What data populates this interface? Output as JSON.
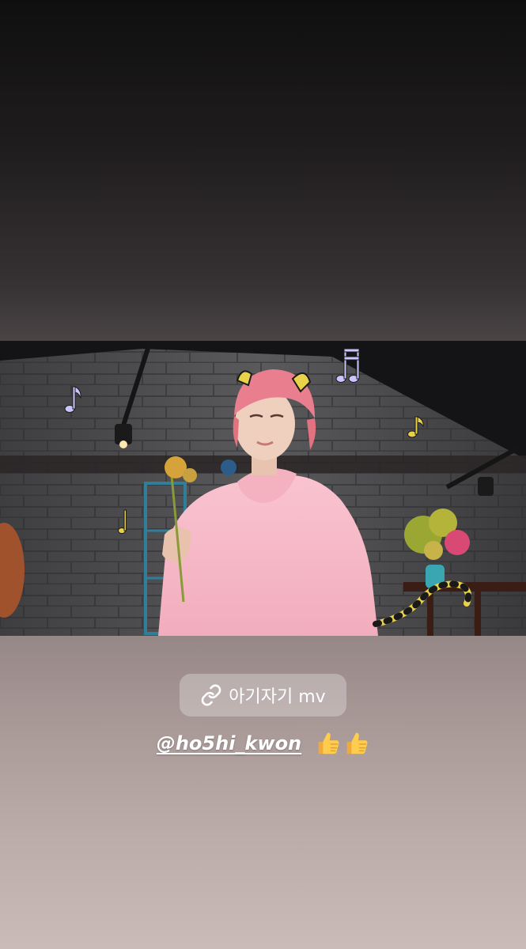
{
  "story": {
    "media": {
      "description_icon": "music-video-still",
      "accent_colors": {
        "hoodie": "#f6b8c4",
        "hair": "#e97f8e",
        "wall": "#4a4a4c",
        "sticker_note_purple": "#c9c6ff",
        "sticker_note_yellow": "#e8d24a"
      }
    },
    "link_sticker": {
      "icon": "link-icon",
      "label": "아기자기 mv"
    },
    "mention": {
      "handle": "@ho5hi_kwon",
      "emoji": "thumbs-up-icon"
    }
  }
}
